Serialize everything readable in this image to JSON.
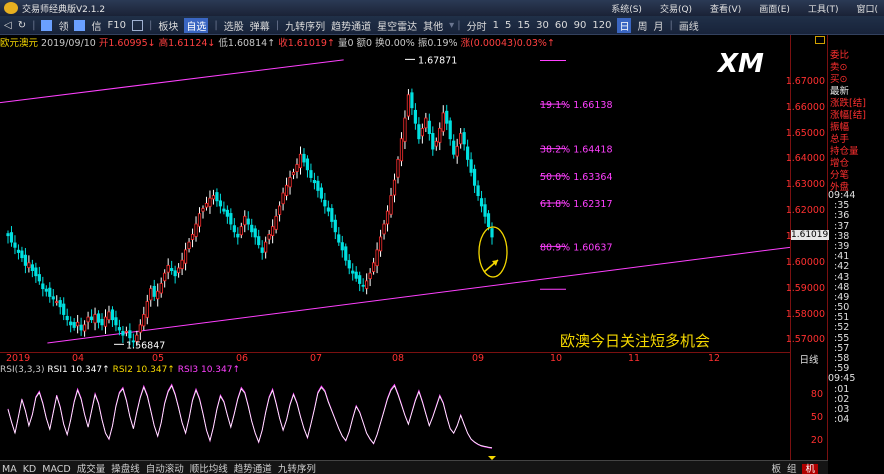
{
  "app": {
    "title": "交易师经典版V2.1.2",
    "badge": "",
    "menu": [
      "系统(S)",
      "交易(Q)",
      "查看(V)",
      "画面(E)",
      "工具(T)",
      "窗口("
    ]
  },
  "toolbar": {
    "items": [
      "领",
      "信",
      "F10",
      "板块",
      "自选",
      "选股",
      "弹幕",
      "九转序列",
      "趋势通道",
      "星空雷达",
      "其他",
      "分时",
      "1",
      "5",
      "15",
      "30",
      "60",
      "90",
      "120",
      "日",
      "周",
      "月",
      "画线"
    ],
    "active_items": [
      "自选",
      "日"
    ]
  },
  "info": {
    "symbol": "欧元澳元",
    "date": "2019/09/10",
    "open": "开1.60995↓",
    "high": "高1.61124↓",
    "low": "低1.60814↑",
    "close": "收1.61019↑",
    "volume": "量0",
    "amount": "额0",
    "turnover": "换0.00%",
    "amplitude": "振0.19%",
    "change": "涨(0.00043)0.03%↑"
  },
  "chart_data": {
    "type": "candlestick",
    "symbol": "欧元澳元",
    "y_ticks": [
      "1.67000",
      "1.66000",
      "1.65000",
      "1.64000",
      "1.63000",
      "1.62000",
      "1.61000",
      "1.60000",
      "1.59000",
      "1.58000",
      "1.57000"
    ],
    "ylim": [
      1.5655,
      1.6835
    ],
    "x_ticks": [
      "2019",
      "04",
      "05",
      "06",
      "07",
      "08",
      "09",
      "10",
      "11",
      "12"
    ],
    "current_price": "1.61019",
    "high_label": "1.67871",
    "low_label": "1.56847",
    "fibonacci": [
      {
        "label": "19.1% 1.66138",
        "value": 1.66138
      },
      {
        "label": "38.2% 1.64418",
        "value": 1.64418
      },
      {
        "label": "50.0% 1.63364",
        "value": 1.63364
      },
      {
        "label": "61.8% 1.62317",
        "value": 1.62317
      },
      {
        "label": "80.9% 1.60637",
        "value": 1.60637
      }
    ],
    "fib_end_marks": [
      1.6783,
      1.5898
    ],
    "upper_trendline": [
      [
        0.0,
        1.662
      ],
      [
        0.435,
        1.6785
      ]
    ],
    "lower_trendline": [
      [
        0.06,
        1.569
      ],
      [
        1.0,
        1.606
      ]
    ],
    "closes": [
      1.6105,
      1.608,
      1.606,
      1.604,
      1.602,
      1.599,
      1.6,
      1.597,
      1.595,
      1.593,
      1.59,
      1.589,
      1.587,
      1.586,
      1.585,
      1.583,
      1.58,
      1.578,
      1.576,
      1.575,
      1.577,
      1.574,
      1.576,
      1.579,
      1.578,
      1.58,
      1.577,
      1.576,
      1.579,
      1.581,
      1.578,
      1.576,
      1.574,
      1.572,
      1.5735,
      1.571,
      1.5695,
      1.572,
      1.576,
      1.58,
      1.585,
      1.59,
      1.587,
      1.589,
      1.592,
      1.596,
      1.599,
      1.597,
      1.595,
      1.598,
      1.601,
      1.605,
      1.608,
      1.611,
      1.615,
      1.619,
      1.621,
      1.623,
      1.625,
      1.626,
      1.624,
      1.622,
      1.62,
      1.618,
      1.615,
      1.612,
      1.61,
      1.614,
      1.618,
      1.615,
      1.612,
      1.61,
      1.607,
      1.604,
      1.608,
      1.611,
      1.614,
      1.618,
      1.622,
      1.627,
      1.63,
      1.633,
      1.635,
      1.638,
      1.642,
      1.639,
      1.636,
      1.633,
      1.631,
      1.628,
      1.625,
      1.622,
      1.62,
      1.616,
      1.612,
      1.608,
      1.605,
      1.601,
      1.598,
      1.596,
      1.594,
      1.592,
      1.591,
      1.593,
      1.596,
      1.6,
      1.605,
      1.61,
      1.615,
      1.62,
      1.626,
      1.632,
      1.64,
      1.648,
      1.656,
      1.665,
      1.66,
      1.654,
      1.648,
      1.652,
      1.656,
      1.65,
      1.644,
      1.647,
      1.652,
      1.658,
      1.654,
      1.648,
      1.642,
      1.645,
      1.65,
      1.646,
      1.64,
      1.635,
      1.63,
      1.626,
      1.622,
      1.618,
      1.614,
      1.61
    ],
    "rsi": {
      "label": "RSI(3,3,3)",
      "series": [
        {
          "name": "RSI1",
          "value": "10.347↑",
          "color": "#ffffff"
        },
        {
          "name": "RSI2",
          "value": "10.347↑",
          "color": "#f5d800"
        },
        {
          "name": "RSI3",
          "value": "10.347↑",
          "color": "#ff40ff"
        }
      ],
      "y_ticks": [
        "80",
        "50",
        "20"
      ],
      "values": [
        62,
        45,
        30,
        52,
        75,
        60,
        40,
        55,
        78,
        85,
        70,
        50,
        35,
        58,
        80,
        65,
        42,
        28,
        48,
        72,
        88,
        76,
        55,
        38,
        60,
        82,
        70,
        48,
        30,
        22,
        40,
        66,
        84,
        90,
        74,
        52,
        36,
        58,
        78,
        92,
        80,
        60,
        40,
        26,
        44,
        70,
        86,
        94,
        82,
        64,
        44,
        30,
        50,
        74,
        88,
        76,
        56,
        34,
        20,
        38,
        62,
        80,
        72,
        54,
        38,
        56,
        76,
        90,
        84,
        66,
        46,
        30,
        18,
        34,
        58,
        78,
        88,
        70,
        50,
        34,
        48,
        68,
        82,
        70,
        52,
        36,
        24,
        42,
        62,
        84,
        92,
        86,
        72,
        60,
        48,
        36,
        26,
        20,
        32,
        50,
        66,
        58,
        44,
        30,
        22,
        16,
        28,
        44,
        60,
        76,
        88,
        94,
        82,
        68,
        54,
        42,
        58,
        74,
        86,
        72,
        56,
        40,
        52,
        66,
        80,
        70,
        52,
        36,
        30,
        40,
        54,
        42,
        30,
        22,
        18,
        15,
        13,
        12,
        11,
        10.3
      ]
    }
  },
  "annotation": "欧澳今日关注短多机会",
  "watermark": "XM",
  "sidepanel": {
    "labels": [
      "委比",
      "卖⊙",
      "买⊙",
      "最新",
      "涨跌[结]",
      "涨幅[结]",
      "振幅",
      "总手",
      "持仓量",
      "增仓",
      "分笔",
      "外盘"
    ],
    "times": [
      "09:44",
      ":35",
      ":36",
      ":37",
      ":38",
      ":39",
      ":41",
      ":42",
      ":43",
      ":48",
      ":49",
      ":50",
      ":51",
      ":52",
      ":55",
      ":57",
      ":58",
      ":59",
      "09:45",
      ":01",
      ":02",
      ":03",
      ":04"
    ],
    "day_tab": "日线"
  },
  "bottombar": {
    "indicators": [
      "MA",
      "KD",
      "MACD",
      "成交量",
      "操盘线",
      "自动滚动",
      "顺比均线",
      "趋势通道",
      "九转序列"
    ],
    "tabs": [
      "板",
      "组",
      "机"
    ]
  }
}
